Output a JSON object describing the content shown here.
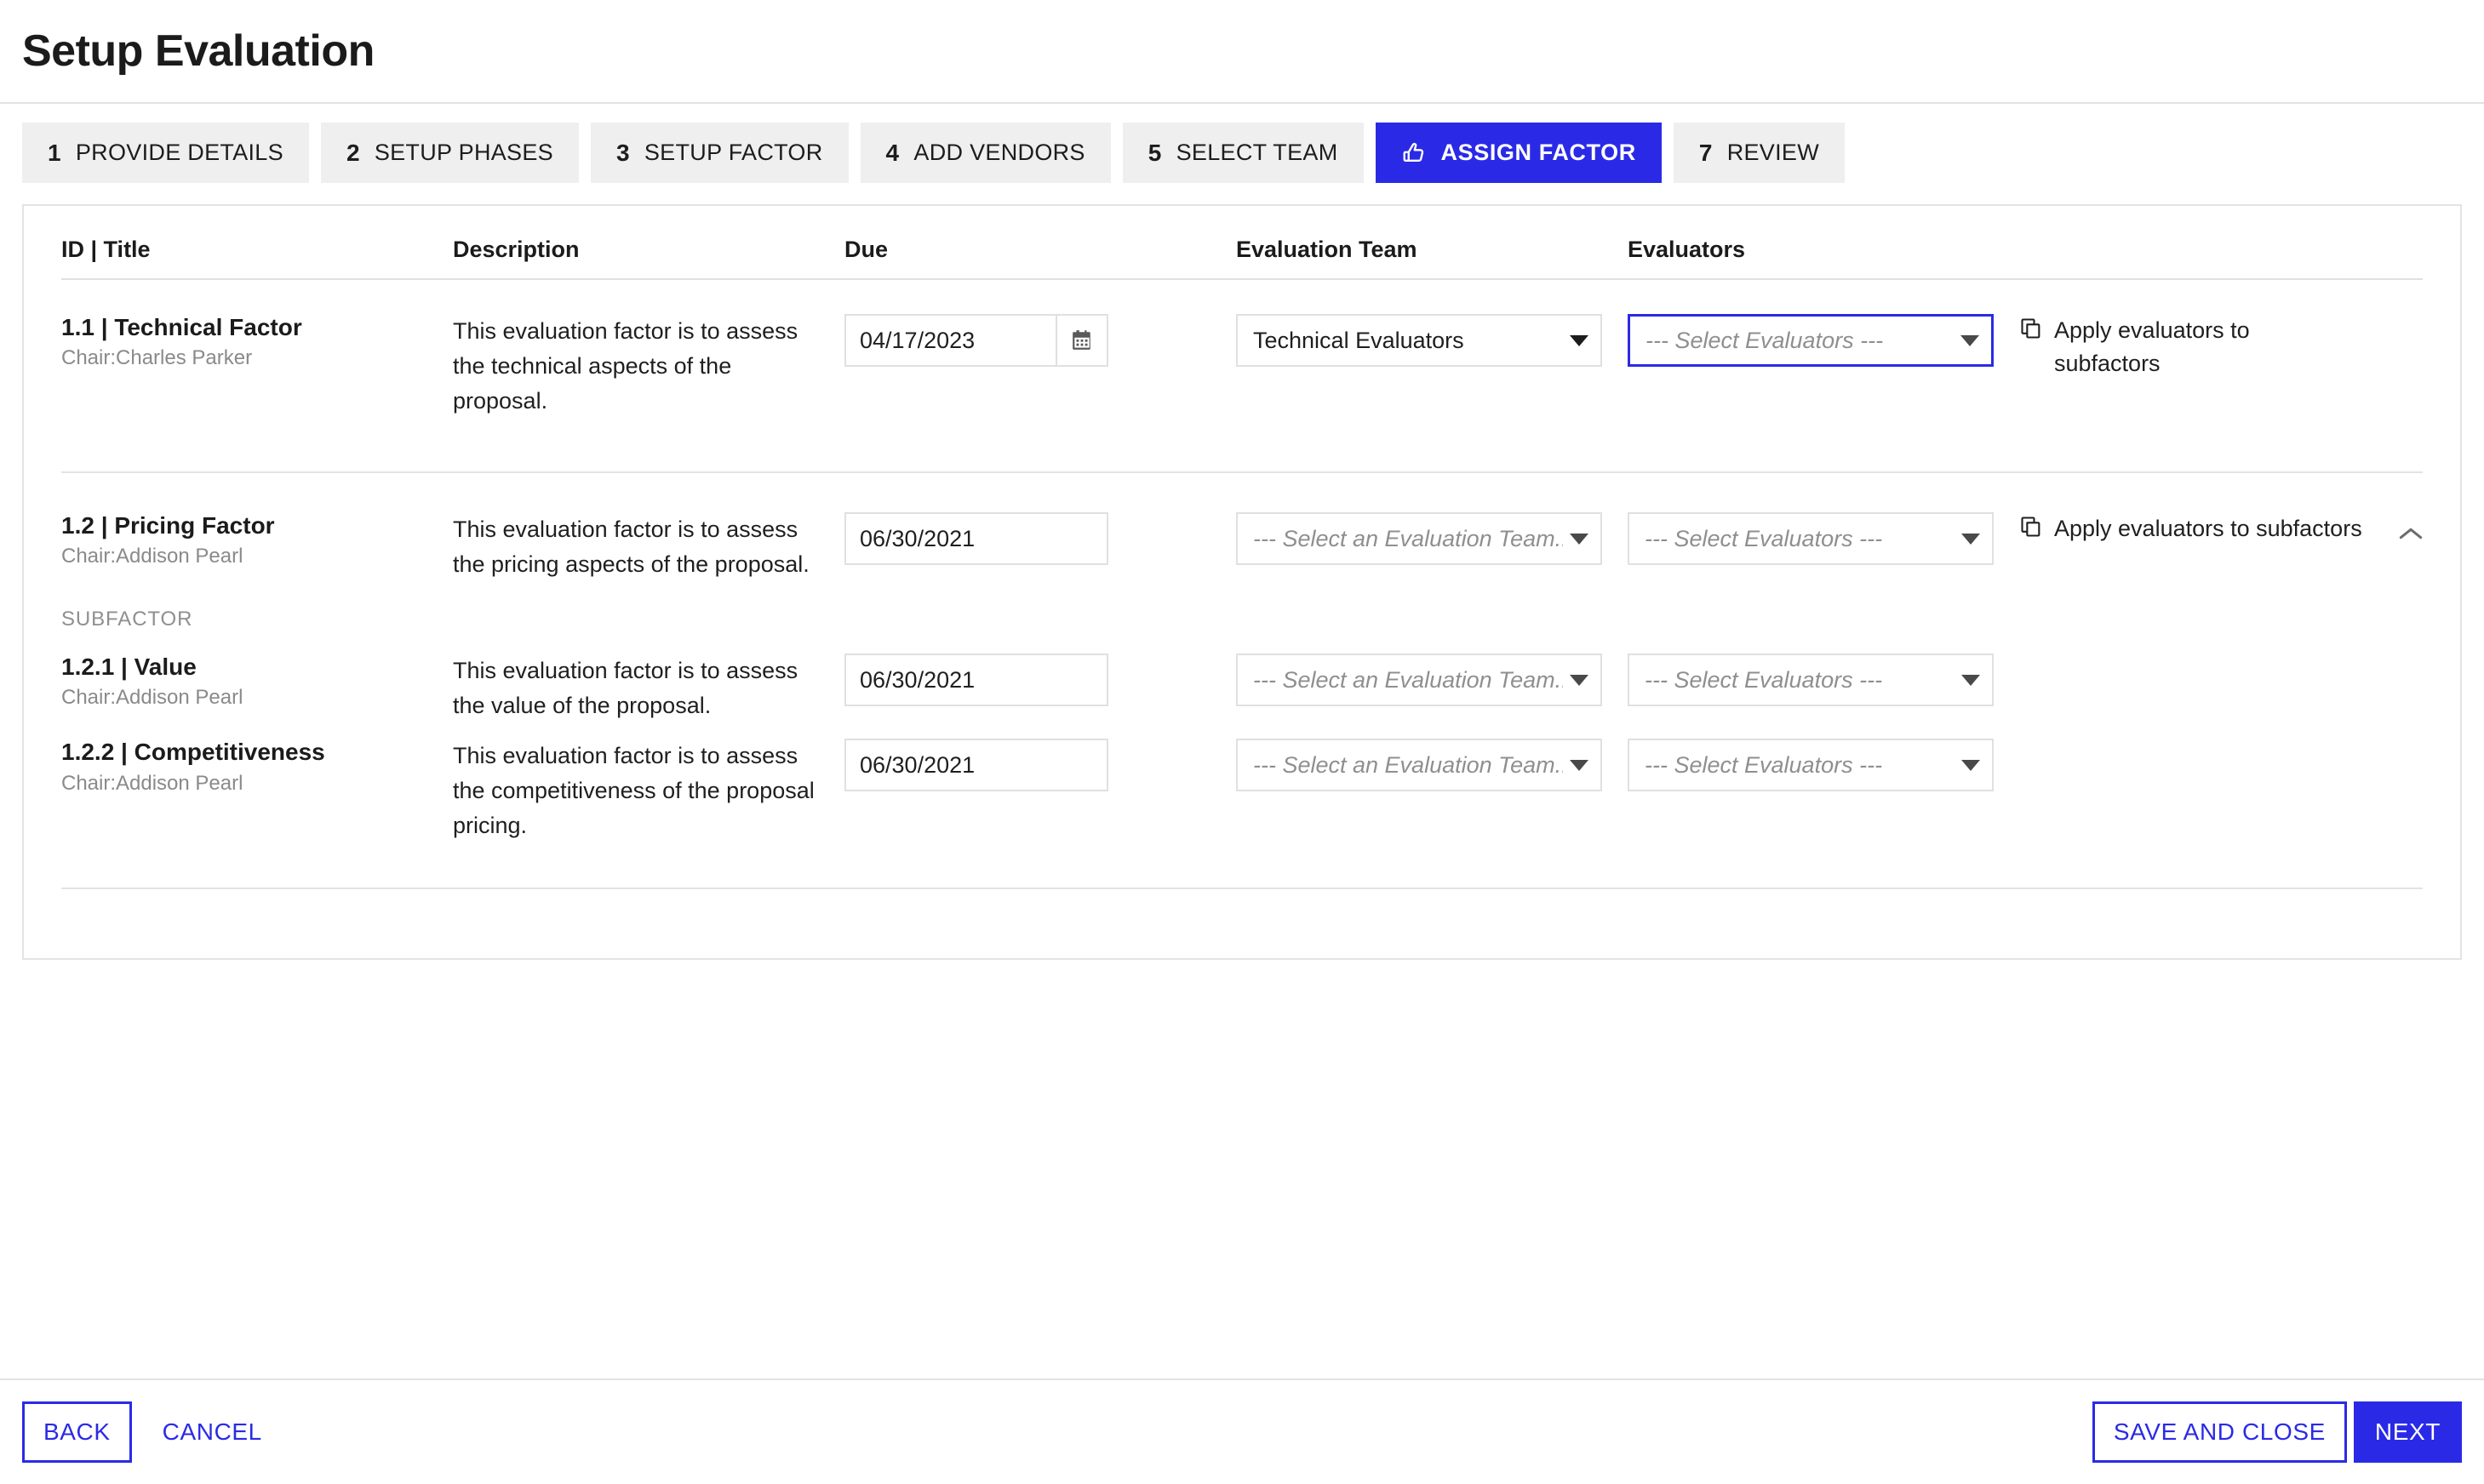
{
  "page": {
    "title": "Setup Evaluation"
  },
  "stepper": {
    "steps": [
      {
        "num": "1",
        "label": "PROVIDE DETAILS",
        "active": false,
        "icon": ""
      },
      {
        "num": "2",
        "label": "SETUP PHASES",
        "active": false,
        "icon": ""
      },
      {
        "num": "3",
        "label": "SETUP FACTOR",
        "active": false,
        "icon": ""
      },
      {
        "num": "4",
        "label": "ADD VENDORS",
        "active": false,
        "icon": ""
      },
      {
        "num": "5",
        "label": "SELECT TEAM",
        "active": false,
        "icon": ""
      },
      {
        "num": "",
        "label": "ASSIGN FACTOR",
        "active": true,
        "icon": "thumbs-up-icon"
      },
      {
        "num": "7",
        "label": "REVIEW",
        "active": false,
        "icon": ""
      }
    ]
  },
  "table": {
    "headers": {
      "id_title": "ID | Title",
      "description": "Description",
      "due": "Due",
      "evaluation_team": "Evaluation Team",
      "evaluators": "Evaluators"
    },
    "subfactor_label": "SUBFACTOR",
    "apply_label": "Apply evaluators to subfactors",
    "rows": [
      {
        "id_title": "1.1 | Technical Factor",
        "chair": "Chair:Charles Parker",
        "description": "This evaluation factor is to assess the technical aspects of the proposal.",
        "due": "04/17/2023",
        "has_calendar": true,
        "team_value": "Technical Evaluators",
        "team_is_placeholder": false,
        "evaluators_value": "--- Select Evaluators ---",
        "evaluators_is_placeholder": true,
        "evaluators_focused": true
      },
      {
        "id_title": "1.2 | Pricing Factor",
        "chair": "Chair:Addison Pearl",
        "description": "This evaluation factor is to assess the pricing aspects of the proposal.",
        "due": "06/30/2021",
        "has_calendar": false,
        "team_value": "--- Select an Evaluation Team...",
        "team_is_placeholder": true,
        "evaluators_value": "--- Select Evaluators ---",
        "evaluators_is_placeholder": true,
        "evaluators_focused": false
      },
      {
        "id_title": "1.2.1 | Value",
        "chair": "Chair:Addison Pearl",
        "description": "This evaluation factor is to assess the value of the proposal.",
        "due": "06/30/2021",
        "has_calendar": false,
        "team_value": "--- Select an Evaluation Team...",
        "team_is_placeholder": true,
        "evaluators_value": "--- Select Evaluators ---",
        "evaluators_is_placeholder": true,
        "evaluators_focused": false
      },
      {
        "id_title": "1.2.2 | Competitiveness",
        "chair": "Chair:Addison Pearl",
        "description": "This evaluation factor is to assess the competitiveness of the proposal pricing.",
        "due": "06/30/2021",
        "has_calendar": false,
        "team_value": "--- Select an Evaluation Team...",
        "team_is_placeholder": true,
        "evaluators_value": "--- Select Evaluators ---",
        "evaluators_is_placeholder": true,
        "evaluators_focused": false
      }
    ]
  },
  "footer": {
    "back": "BACK",
    "cancel": "CANCEL",
    "save_and_close": "SAVE AND CLOSE",
    "next": "NEXT"
  },
  "colors": {
    "accent": "#2a2ae6",
    "tab_bg": "#efefef",
    "border": "#e0e0e0",
    "muted_text": "#8f8f8f"
  }
}
